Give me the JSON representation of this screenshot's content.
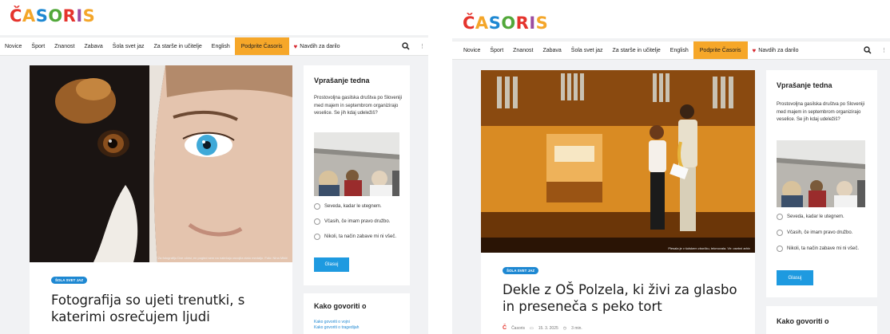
{
  "logo_text": "ČASORIS",
  "logo_colors": [
    "#e5342d",
    "#f4a62a",
    "#1e88d2",
    "#52a83a",
    "#e5342d",
    "#9b4ba0",
    "#f4a62a"
  ],
  "nav": {
    "items": [
      "Novice",
      "Šport",
      "Znanost",
      "Zabava",
      "Šola svet jaz",
      "Za starše in učitelje",
      "English"
    ],
    "highlight": "Podprite Časoris",
    "gift": "Navdih za darilo"
  },
  "sidebar": {
    "title": "Vprašanje tedna",
    "question": "Prostovoljna gasilska društva po Sloveniji med majem in septembrom organizirajo veselice. Se jih kdaj udeležiš?",
    "options": [
      "Seveda, kadar le utegnem.",
      "Včasih, če imam pravo družbo.",
      "Nikoli, ta način zabave mi ni všeč."
    ],
    "vote": "Glasuj",
    "second_title": "Kako govoriti o",
    "links": [
      "Kako govoriti o vojni",
      "Kako govoriti o tragedijah"
    ]
  },
  "left_article": {
    "badge": "Šola svet jaz",
    "title": "Fotografija so ujeti trenutki, s katerimi osrečujem ljudi",
    "caption": "Za fotografijo Dve očesi, en pogled sem na natečaju osvojila zlato medaljo. Foto: Nina Mikič"
  },
  "right_article": {
    "badge": "Šola svet jaz",
    "title": "Dekle z OŠ Polzela, ki živi za glasbo in preseneča s peko tort",
    "caption": "Plesala je v šolskem zborčku, tekmovala. Vir: osebni arhiv",
    "author": "Časoris",
    "date": "15. 3. 2025",
    "read": "3 min."
  }
}
